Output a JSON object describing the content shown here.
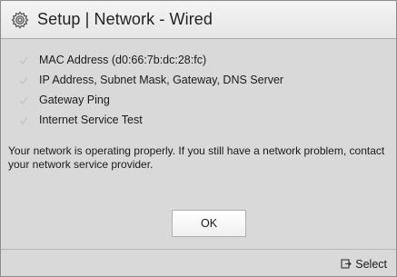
{
  "header": {
    "title": "Setup | Network - Wired",
    "icon": "gear-icon"
  },
  "checklist": {
    "items": [
      {
        "label": "MAC Address (d0:66:7b:dc:28:fc)",
        "icon": "check-icon"
      },
      {
        "label": "IP Address, Subnet Mask, Gateway, DNS Server",
        "icon": "check-icon"
      },
      {
        "label": "Gateway Ping",
        "icon": "check-icon"
      },
      {
        "label": "Internet Service Test",
        "icon": "check-icon"
      }
    ]
  },
  "message": {
    "text": "Your network is operating properly. If you still have a network problem, contact your network service provider."
  },
  "actions": {
    "ok_label": "OK"
  },
  "footer": {
    "select_label": "Select",
    "select_icon": "enter-key-icon"
  },
  "colors": {
    "panel_background": "#d9d9d9",
    "title_background": "#eeeeee",
    "check_mark": "#c4c4c4",
    "text": "#1a1a1a"
  }
}
